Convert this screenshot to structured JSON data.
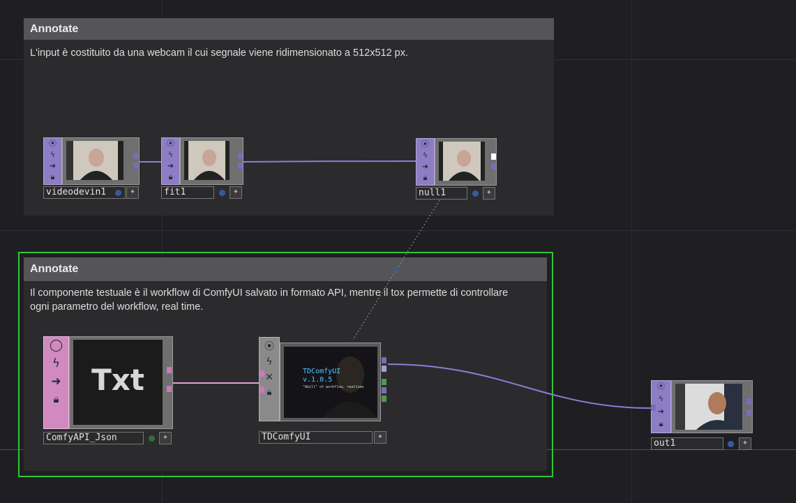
{
  "annotations": [
    {
      "title": "Annotate",
      "body": "L'input è costituito da una webcam il cui segnale viene ridimensionato a 512x512 px."
    },
    {
      "title": "Annotate",
      "body": "Il componente testuale è il workflow di ComfyUI salvato in formato API, mentre il tox permette di controllare ogni parametro del workflow, real time."
    }
  ],
  "nodes": {
    "videodevin1": {
      "name": "videodevin1",
      "family": "TOP",
      "preview": "webcam-portrait"
    },
    "fit1": {
      "name": "fit1",
      "family": "TOP",
      "preview": "webcam-portrait"
    },
    "null1": {
      "name": "null1",
      "family": "TOP",
      "preview": "webcam-portrait"
    },
    "comfyapi_json": {
      "name": "ComfyAPI_Json",
      "family": "DAT",
      "preview_text": "Txt"
    },
    "tdcomfyui": {
      "name": "TDComfyUI",
      "family": "COMP",
      "preview_title": "TDComfyUI",
      "preview_version": "v.1.0.5",
      "preview_note": "\"Abill\" of workflow, realtime"
    },
    "out1": {
      "name": "out1",
      "family": "TOP",
      "preview": "generated-portrait"
    }
  },
  "colors": {
    "background": "#1f1f23",
    "top_family": "#8d7dc4",
    "dat_family": "#d08ac0",
    "selection": "#2ec635",
    "wire_top": "#8d7dd8",
    "wire_dat": "#e2a0d4"
  },
  "icons": {
    "viewer_toggle": "circle-icon",
    "bypass": "lightning-icon",
    "export": "arrow-right-icon",
    "lock": "lock-icon",
    "close": "x-icon",
    "pin": "pin-icon"
  }
}
